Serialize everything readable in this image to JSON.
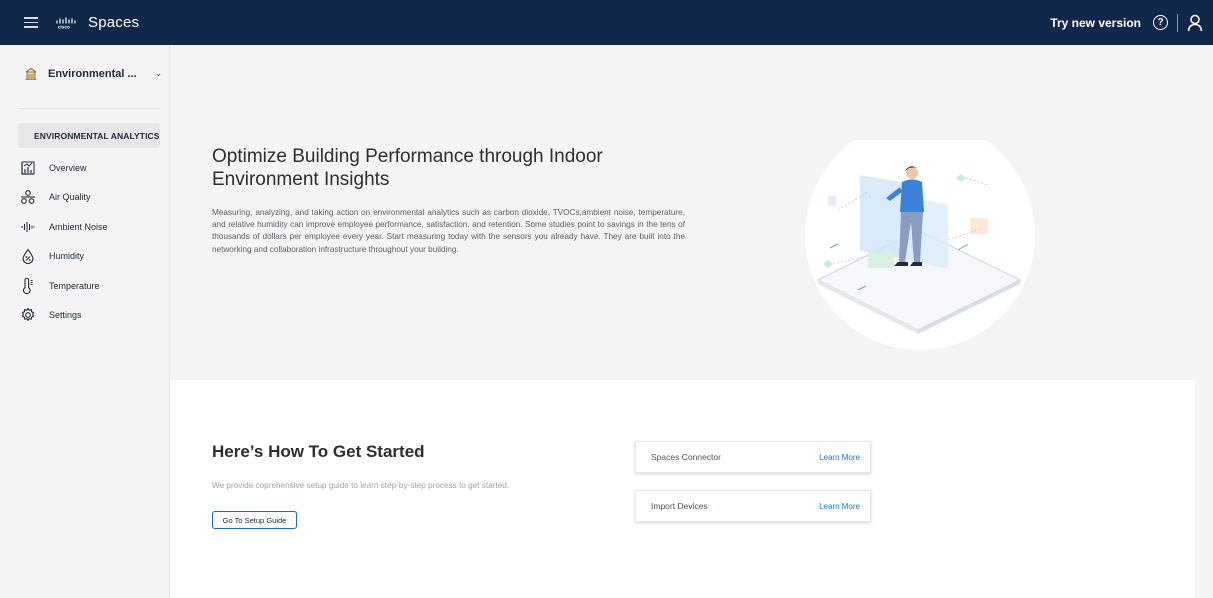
{
  "header": {
    "brand_small": "cisco",
    "app_name": "Spaces",
    "try_new_version": "Try new version",
    "help_symbol": "?",
    "icons": [
      "menu-icon",
      "cisco-logo",
      "help-icon",
      "user-icon"
    ]
  },
  "sidebar": {
    "space_selector": {
      "label": "Environmental ...",
      "icon": "building-icon"
    },
    "section_title": "ENVIRONMENTAL ANALYTICS",
    "items": [
      {
        "label": "Overview",
        "icon": "overview-chart-icon"
      },
      {
        "label": "Air Quality",
        "icon": "air-quality-icon"
      },
      {
        "label": "Ambient Noise",
        "icon": "ambient-noise-icon"
      },
      {
        "label": "Humidity",
        "icon": "humidity-icon"
      },
      {
        "label": "Temperature",
        "icon": "thermometer-icon"
      },
      {
        "label": "Settings",
        "icon": "gear-icon"
      }
    ]
  },
  "hero": {
    "title": "Optimize Building Performance through Indoor Environment Insights",
    "description": "Measuring, analyzing, and taking action on environmental analytics such as carbon dioxide, TVOCs,ambient noise, temperature, and relative humidity can improve employee performance, satisfaction, and retention. Some studies point to savings in the tens of thousands of dollars per employee every year. Start measuring today with the sensors you already have. They are built into the networking and collaboration infrastructure throughout your building."
  },
  "get_started": {
    "title": "Here’s How To Get Started",
    "description": "We provide coprehensive setup guide to learn step-by-step process to get started.",
    "button": "Go To Setup Guide",
    "cards": [
      {
        "title": "Spaces Connector",
        "link": "Learn More"
      },
      {
        "title": "Import Devices",
        "link": "Learn More"
      }
    ]
  },
  "colors": {
    "topbar": "#12284a",
    "accent_link": "#1d78d0",
    "page_bg": "#f4f4f5"
  }
}
